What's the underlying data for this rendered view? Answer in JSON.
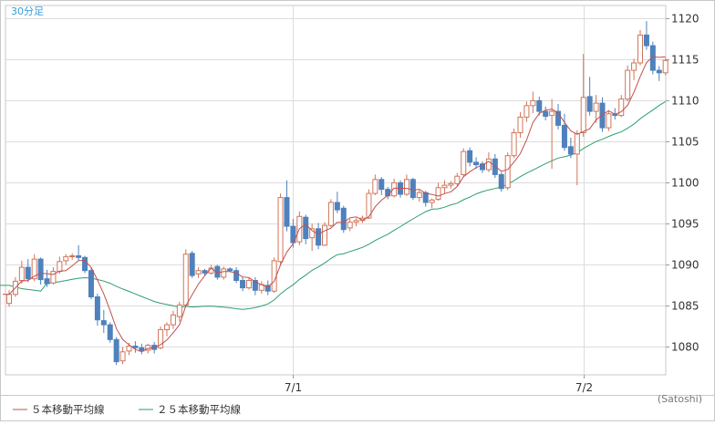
{
  "chart_data": {
    "type": "candlestick",
    "timeframe_label": "30分足",
    "credit": "(Satoshi)",
    "y_ticks": [
      1080,
      1085,
      1090,
      1095,
      1100,
      1105,
      1110,
      1115,
      1120
    ],
    "ylim": [
      1076.5,
      1121.5
    ],
    "x_ticks": [
      {
        "label": "7/1",
        "index": 45
      },
      {
        "label": "7/2",
        "index": 91
      }
    ],
    "legend": [
      {
        "label": "５本移動平均線",
        "color": "#c0504d"
      },
      {
        "label": "２５本移動平均線",
        "color": "#2e9e6e"
      }
    ],
    "colors": {
      "up": "#d0755a",
      "down": "#4f81bd",
      "ma5": "#c0504d",
      "ma25": "#2e9e6e",
      "grid": "#dcdcdc"
    },
    "candles": [
      [
        1085.2,
        1086.8,
        1084.8,
        1086.3
      ],
      [
        1086.3,
        1088.4,
        1086.0,
        1087.9
      ],
      [
        1088.0,
        1090.4,
        1087.6,
        1089.6
      ],
      [
        1089.6,
        1090.6,
        1087.8,
        1088.2
      ],
      [
        1088.2,
        1091.2,
        1087.9,
        1090.6
      ],
      [
        1090.6,
        1090.8,
        1087.5,
        1088.1
      ],
      [
        1088.2,
        1089.3,
        1087.2,
        1087.6
      ],
      [
        1087.7,
        1089.6,
        1087.5,
        1089.1
      ],
      [
        1089.1,
        1090.9,
        1088.8,
        1090.3
      ],
      [
        1090.4,
        1091.2,
        1089.9,
        1090.9
      ],
      [
        1090.9,
        1091.3,
        1090.5,
        1091.0
      ],
      [
        1091.0,
        1092.3,
        1090.4,
        1090.8
      ],
      [
        1090.8,
        1091.0,
        1088.9,
        1089.2
      ],
      [
        1089.2,
        1089.5,
        1085.7,
        1086.0
      ],
      [
        1086.0,
        1086.4,
        1082.5,
        1083.2
      ],
      [
        1083.1,
        1084.4,
        1081.6,
        1082.6
      ],
      [
        1082.6,
        1082.9,
        1080.4,
        1080.8
      ],
      [
        1080.8,
        1081.1,
        1077.7,
        1078.1
      ],
      [
        1078.2,
        1079.9,
        1077.8,
        1079.3
      ],
      [
        1079.4,
        1080.4,
        1078.9,
        1080.0
      ],
      [
        1080.0,
        1080.6,
        1079.2,
        1079.8
      ],
      [
        1079.8,
        1080.3,
        1079.0,
        1079.4
      ],
      [
        1079.5,
        1080.3,
        1079.1,
        1080.1
      ],
      [
        1080.1,
        1080.5,
        1079.1,
        1079.6
      ],
      [
        1079.8,
        1082.4,
        1079.6,
        1082.0
      ],
      [
        1082.0,
        1082.9,
        1081.2,
        1082.6
      ],
      [
        1082.6,
        1084.3,
        1082.1,
        1083.8
      ],
      [
        1083.6,
        1085.4,
        1083.0,
        1085.0
      ],
      [
        1085.0,
        1091.8,
        1084.8,
        1091.2
      ],
      [
        1091.3,
        1091.6,
        1088.3,
        1088.6
      ],
      [
        1088.8,
        1089.6,
        1088.3,
        1089.2
      ],
      [
        1089.2,
        1089.4,
        1088.6,
        1088.9
      ],
      [
        1088.9,
        1089.9,
        1088.7,
        1089.5
      ],
      [
        1089.7,
        1089.9,
        1088.1,
        1088.4
      ],
      [
        1088.4,
        1089.7,
        1088.1,
        1089.4
      ],
      [
        1089.4,
        1089.6,
        1089.0,
        1089.2
      ],
      [
        1089.2,
        1089.6,
        1087.7,
        1088.0
      ],
      [
        1088.0,
        1088.4,
        1086.7,
        1087.1
      ],
      [
        1087.1,
        1088.3,
        1086.9,
        1088.0
      ],
      [
        1088.0,
        1088.4,
        1086.2,
        1086.8
      ],
      [
        1086.8,
        1087.9,
        1086.4,
        1087.5
      ],
      [
        1087.4,
        1088.0,
        1086.2,
        1086.7
      ],
      [
        1086.7,
        1090.8,
        1086.5,
        1090.4
      ],
      [
        1090.3,
        1098.6,
        1090.0,
        1098.1
      ],
      [
        1098.1,
        1100.2,
        1094.0,
        1094.6
      ],
      [
        1094.6,
        1095.5,
        1092.0,
        1092.6
      ],
      [
        1092.7,
        1096.4,
        1092.3,
        1095.8
      ],
      [
        1095.7,
        1096.0,
        1092.4,
        1093.1
      ],
      [
        1093.2,
        1094.9,
        1091.6,
        1094.3
      ],
      [
        1094.3,
        1095.0,
        1091.8,
        1092.3
      ],
      [
        1092.3,
        1095.1,
        1092.2,
        1094.7
      ],
      [
        1094.7,
        1097.9,
        1094.5,
        1097.5
      ],
      [
        1097.5,
        1098.8,
        1096.2,
        1096.6
      ],
      [
        1096.8,
        1097.1,
        1093.8,
        1094.2
      ],
      [
        1094.4,
        1095.5,
        1094.0,
        1095.1
      ],
      [
        1095.1,
        1095.6,
        1094.6,
        1095.3
      ],
      [
        1095.3,
        1095.9,
        1095.0,
        1095.6
      ],
      [
        1095.6,
        1099.1,
        1095.5,
        1098.6
      ],
      [
        1098.6,
        1100.9,
        1098.4,
        1100.3
      ],
      [
        1100.3,
        1100.6,
        1098.4,
        1099.1
      ],
      [
        1099.1,
        1099.4,
        1097.9,
        1098.3
      ],
      [
        1098.3,
        1100.4,
        1098.1,
        1099.9
      ],
      [
        1099.9,
        1100.2,
        1098.1,
        1098.5
      ],
      [
        1098.5,
        1100.9,
        1098.3,
        1100.3
      ],
      [
        1100.3,
        1100.5,
        1097.8,
        1098.1
      ],
      [
        1098.1,
        1099.0,
        1097.6,
        1098.7
      ],
      [
        1098.7,
        1098.9,
        1097.0,
        1097.5
      ],
      [
        1097.5,
        1098.0,
        1096.8,
        1097.8
      ],
      [
        1097.9,
        1099.9,
        1097.7,
        1099.3
      ],
      [
        1099.3,
        1100.2,
        1098.6,
        1099.6
      ],
      [
        1099.6,
        1100.1,
        1099.2,
        1099.8
      ],
      [
        1099.8,
        1101.1,
        1099.5,
        1100.7
      ],
      [
        1100.9,
        1104.1,
        1100.6,
        1103.7
      ],
      [
        1103.8,
        1104.2,
        1101.9,
        1102.4
      ],
      [
        1102.4,
        1103.0,
        1101.6,
        1102.1
      ],
      [
        1102.2,
        1102.5,
        1101.1,
        1101.5
      ],
      [
        1101.5,
        1103.6,
        1101.2,
        1102.8
      ],
      [
        1102.8,
        1103.4,
        1100.5,
        1100.9
      ],
      [
        1100.9,
        1101.2,
        1098.8,
        1099.2
      ],
      [
        1099.3,
        1103.6,
        1099.0,
        1103.2
      ],
      [
        1103.2,
        1106.5,
        1102.9,
        1106.0
      ],
      [
        1106.0,
        1108.5,
        1105.4,
        1107.9
      ],
      [
        1107.9,
        1109.8,
        1107.3,
        1109.3
      ],
      [
        1109.3,
        1111.0,
        1108.4,
        1109.9
      ],
      [
        1109.9,
        1110.4,
        1108.1,
        1108.6
      ],
      [
        1108.6,
        1109.2,
        1107.5,
        1108.0
      ],
      [
        1108.1,
        1110.1,
        1101.6,
        1108.6
      ],
      [
        1108.6,
        1109.5,
        1106.4,
        1106.9
      ],
      [
        1106.9,
        1108.3,
        1103.8,
        1104.2
      ],
      [
        1104.3,
        1105.4,
        1102.9,
        1103.4
      ],
      [
        1103.4,
        1106.3,
        1099.6,
        1105.9
      ],
      [
        1106.0,
        1115.6,
        1105.5,
        1110.3
      ],
      [
        1110.4,
        1112.8,
        1108.1,
        1108.6
      ],
      [
        1108.6,
        1110.6,
        1107.2,
        1109.6
      ],
      [
        1109.6,
        1110.3,
        1106.1,
        1106.6
      ],
      [
        1106.6,
        1108.7,
        1106.2,
        1108.3
      ],
      [
        1108.3,
        1109.0,
        1107.6,
        1108.1
      ],
      [
        1108.1,
        1110.6,
        1107.9,
        1110.1
      ],
      [
        1110.1,
        1114.2,
        1109.8,
        1113.6
      ],
      [
        1113.6,
        1115.0,
        1112.4,
        1114.5
      ],
      [
        1114.5,
        1118.5,
        1114.2,
        1117.9
      ],
      [
        1117.9,
        1119.6,
        1116.1,
        1116.6
      ],
      [
        1116.6,
        1117.1,
        1113.1,
        1113.6
      ],
      [
        1113.6,
        1114.1,
        1112.3,
        1113.3
      ],
      [
        1113.3,
        1115.1,
        1113.0,
        1114.8
      ]
    ],
    "ma25_start": [
      1087.4,
      1087.2,
      1087.0,
      1086.9,
      1086.8,
      1086.7
    ]
  }
}
